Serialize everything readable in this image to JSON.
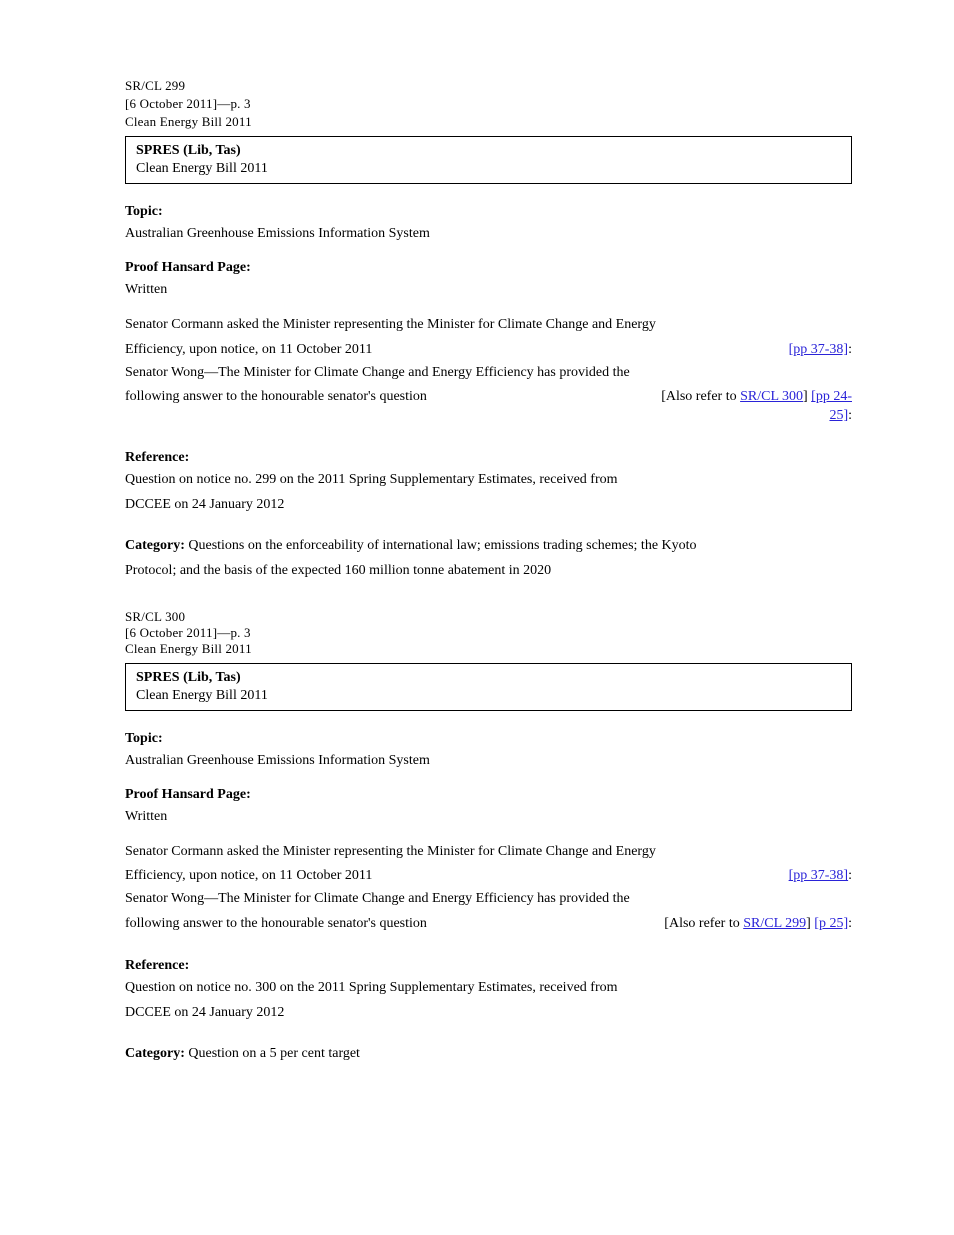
{
  "header": {
    "id": "SR/CL 299",
    "line2": "[6 October 2011]—p. 3",
    "line3": "Clean Energy Bill 2011"
  },
  "item1": {
    "box": {
      "title": "SPRES (Lib, Tas)",
      "subtitle": "Clean Energy Bill 2011"
    },
    "topic_label": "Topic:",
    "topic_value": "Australian Greenhouse Emissions Information System",
    "proof_label": "Proof Hansard Page:",
    "proof_value": "Written",
    "asked_line_prefix": "Senator Cormann asked the Minister representing the Minister for Climate Change and Energy",
    "asked_line_rest": "Efficiency, upon notice, on 11 October 2011",
    "asked_link_text": "[pp 37-38]",
    "asked_suffix": ":",
    "answer_line_prefix": "Senator Wong—The Minister for Climate Change and Energy Efficiency has provided the",
    "answer_line_rest": "following answer to the honourable senator's question",
    "answer_link_first": "[Also refer to ",
    "answer_link_1": "SR/CL 300",
    "answer_link_mid": "] ",
    "answer_link_2": "[pp 24-",
    "answer_link_3": "25]",
    "answer_suffix": ":",
    "ref_label": "Reference:",
    "ref_value": "Question on notice no. 299 on the 2011 Spring Supplementary Estimates, received from",
    "ref_value2": "DCCEE on 24 January 2012",
    "cat_prefix": "Category: ",
    "cat_value": "Questions on the enforceability of international law; emissions trading schemes; the Kyoto",
    "cat_value2": "Protocol; and the basis of the expected 160 million tonne abatement in 2020"
  },
  "item2": {
    "box": {
      "title": "SPRES (Lib, Tas)",
      "subtitle": "Clean Energy Bill 2011"
    },
    "topic_label": "Topic:",
    "topic_value": "Australian Greenhouse Emissions Information System",
    "proof_label": "Proof Hansard Page:",
    "proof_value": "Written",
    "asked_line_prefix": "Senator Cormann asked the Minister representing the Minister for Climate Change and Energy",
    "asked_line_rest": "Efficiency, upon notice, on 11 October 2011",
    "asked_link_text": "[pp 37-38]",
    "asked_suffix": ":",
    "answer_line_prefix": "Senator Wong—The Minister for Climate Change and Energy Efficiency has provided the",
    "answer_line_rest": "following answer to the honourable senator's question",
    "answer_link_first": "[Also refer to ",
    "answer_link_1": "SR/CL 299",
    "answer_link_mid": "] ",
    "answer_link_2": "[p 25]",
    "answer_suffix": ":",
    "ref_label": "Reference:",
    "ref_value": "Question on notice no. 300 on the 2011 Spring Supplementary Estimates, received from",
    "ref_value2": "DCCEE on 24 January 2012",
    "cat_prefix": "Category: ",
    "cat_value": "Question on a 5 per cent target"
  }
}
